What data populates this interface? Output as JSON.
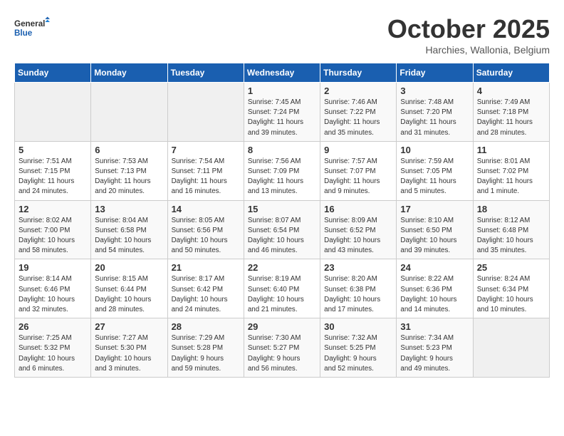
{
  "logo": {
    "line1": "General",
    "line2": "Blue"
  },
  "title": "October 2025",
  "subtitle": "Harchies, Wallonia, Belgium",
  "days_of_week": [
    "Sunday",
    "Monday",
    "Tuesday",
    "Wednesday",
    "Thursday",
    "Friday",
    "Saturday"
  ],
  "weeks": [
    [
      {
        "day": "",
        "info": ""
      },
      {
        "day": "",
        "info": ""
      },
      {
        "day": "",
        "info": ""
      },
      {
        "day": "1",
        "info": "Sunrise: 7:45 AM\nSunset: 7:24 PM\nDaylight: 11 hours\nand 39 minutes."
      },
      {
        "day": "2",
        "info": "Sunrise: 7:46 AM\nSunset: 7:22 PM\nDaylight: 11 hours\nand 35 minutes."
      },
      {
        "day": "3",
        "info": "Sunrise: 7:48 AM\nSunset: 7:20 PM\nDaylight: 11 hours\nand 31 minutes."
      },
      {
        "day": "4",
        "info": "Sunrise: 7:49 AM\nSunset: 7:18 PM\nDaylight: 11 hours\nand 28 minutes."
      }
    ],
    [
      {
        "day": "5",
        "info": "Sunrise: 7:51 AM\nSunset: 7:15 PM\nDaylight: 11 hours\nand 24 minutes."
      },
      {
        "day": "6",
        "info": "Sunrise: 7:53 AM\nSunset: 7:13 PM\nDaylight: 11 hours\nand 20 minutes."
      },
      {
        "day": "7",
        "info": "Sunrise: 7:54 AM\nSunset: 7:11 PM\nDaylight: 11 hours\nand 16 minutes."
      },
      {
        "day": "8",
        "info": "Sunrise: 7:56 AM\nSunset: 7:09 PM\nDaylight: 11 hours\nand 13 minutes."
      },
      {
        "day": "9",
        "info": "Sunrise: 7:57 AM\nSunset: 7:07 PM\nDaylight: 11 hours\nand 9 minutes."
      },
      {
        "day": "10",
        "info": "Sunrise: 7:59 AM\nSunset: 7:05 PM\nDaylight: 11 hours\nand 5 minutes."
      },
      {
        "day": "11",
        "info": "Sunrise: 8:01 AM\nSunset: 7:02 PM\nDaylight: 11 hours\nand 1 minute."
      }
    ],
    [
      {
        "day": "12",
        "info": "Sunrise: 8:02 AM\nSunset: 7:00 PM\nDaylight: 10 hours\nand 58 minutes."
      },
      {
        "day": "13",
        "info": "Sunrise: 8:04 AM\nSunset: 6:58 PM\nDaylight: 10 hours\nand 54 minutes."
      },
      {
        "day": "14",
        "info": "Sunrise: 8:05 AM\nSunset: 6:56 PM\nDaylight: 10 hours\nand 50 minutes."
      },
      {
        "day": "15",
        "info": "Sunrise: 8:07 AM\nSunset: 6:54 PM\nDaylight: 10 hours\nand 46 minutes."
      },
      {
        "day": "16",
        "info": "Sunrise: 8:09 AM\nSunset: 6:52 PM\nDaylight: 10 hours\nand 43 minutes."
      },
      {
        "day": "17",
        "info": "Sunrise: 8:10 AM\nSunset: 6:50 PM\nDaylight: 10 hours\nand 39 minutes."
      },
      {
        "day": "18",
        "info": "Sunrise: 8:12 AM\nSunset: 6:48 PM\nDaylight: 10 hours\nand 35 minutes."
      }
    ],
    [
      {
        "day": "19",
        "info": "Sunrise: 8:14 AM\nSunset: 6:46 PM\nDaylight: 10 hours\nand 32 minutes."
      },
      {
        "day": "20",
        "info": "Sunrise: 8:15 AM\nSunset: 6:44 PM\nDaylight: 10 hours\nand 28 minutes."
      },
      {
        "day": "21",
        "info": "Sunrise: 8:17 AM\nSunset: 6:42 PM\nDaylight: 10 hours\nand 24 minutes."
      },
      {
        "day": "22",
        "info": "Sunrise: 8:19 AM\nSunset: 6:40 PM\nDaylight: 10 hours\nand 21 minutes."
      },
      {
        "day": "23",
        "info": "Sunrise: 8:20 AM\nSunset: 6:38 PM\nDaylight: 10 hours\nand 17 minutes."
      },
      {
        "day": "24",
        "info": "Sunrise: 8:22 AM\nSunset: 6:36 PM\nDaylight: 10 hours\nand 14 minutes."
      },
      {
        "day": "25",
        "info": "Sunrise: 8:24 AM\nSunset: 6:34 PM\nDaylight: 10 hours\nand 10 minutes."
      }
    ],
    [
      {
        "day": "26",
        "info": "Sunrise: 7:25 AM\nSunset: 5:32 PM\nDaylight: 10 hours\nand 6 minutes."
      },
      {
        "day": "27",
        "info": "Sunrise: 7:27 AM\nSunset: 5:30 PM\nDaylight: 10 hours\nand 3 minutes."
      },
      {
        "day": "28",
        "info": "Sunrise: 7:29 AM\nSunset: 5:28 PM\nDaylight: 9 hours\nand 59 minutes."
      },
      {
        "day": "29",
        "info": "Sunrise: 7:30 AM\nSunset: 5:27 PM\nDaylight: 9 hours\nand 56 minutes."
      },
      {
        "day": "30",
        "info": "Sunrise: 7:32 AM\nSunset: 5:25 PM\nDaylight: 9 hours\nand 52 minutes."
      },
      {
        "day": "31",
        "info": "Sunrise: 7:34 AM\nSunset: 5:23 PM\nDaylight: 9 hours\nand 49 minutes."
      },
      {
        "day": "",
        "info": ""
      }
    ]
  ]
}
